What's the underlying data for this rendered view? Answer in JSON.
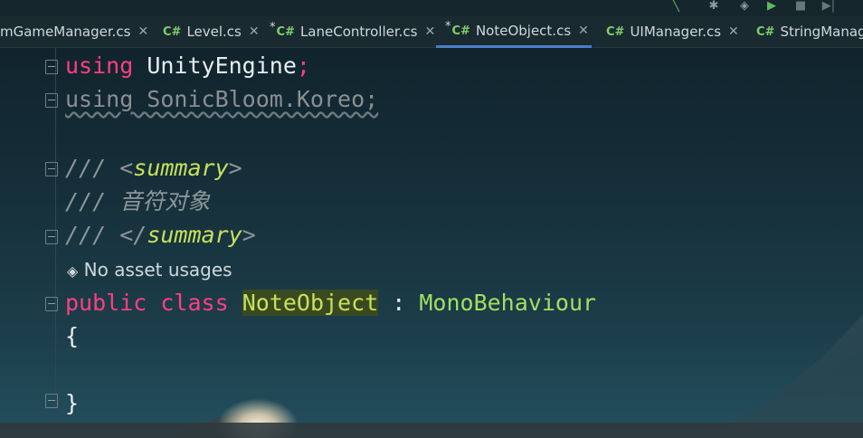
{
  "tabs": [
    {
      "label": "mGameManager.cs",
      "lang": "",
      "modified": false,
      "active": false
    },
    {
      "label": "Level.cs",
      "lang": "C#",
      "modified": false,
      "active": false
    },
    {
      "label": "LaneController.cs",
      "lang": "C#",
      "modified": true,
      "active": false
    },
    {
      "label": "NoteObject.cs",
      "lang": "C#",
      "modified": true,
      "active": true
    },
    {
      "label": "UIManager.cs",
      "lang": "C#",
      "modified": false,
      "active": false
    },
    {
      "label": "StringManag",
      "lang": "C#",
      "modified": false,
      "active": false
    }
  ],
  "close_glyph": "✕",
  "modified_glyph": "*",
  "code": {
    "line1": {
      "kw": "using",
      "id": "UnityEngine",
      "end": ";"
    },
    "line2": {
      "text": "using SonicBloom.Koreo;"
    },
    "line3": {
      "prefix": "/// <",
      "tag": "summary",
      "suffix": ">"
    },
    "line4": {
      "text": "/// 音符对象"
    },
    "line5": {
      "prefix": "/// </",
      "tag": "summary",
      "suffix": ">"
    },
    "usage_hint": "No asset usages",
    "line6": {
      "kw1": "public",
      "kw2": "class",
      "cls": "NoteObject",
      "colon": " : ",
      "base": "MonoBehaviour"
    },
    "open_brace": "{",
    "close_brace": "}"
  },
  "icons": {
    "toolbar": [
      "hammer-icon",
      "bug-icon",
      "unity-icon",
      "run-icon",
      "stop-icon",
      "step-icon"
    ],
    "hint": "unity-icon"
  },
  "colors": {
    "keyword": "#ff3f7f",
    "class_name": "#c6e15c",
    "type": "#9fe060",
    "tab_accent": "#4a7fc8"
  }
}
